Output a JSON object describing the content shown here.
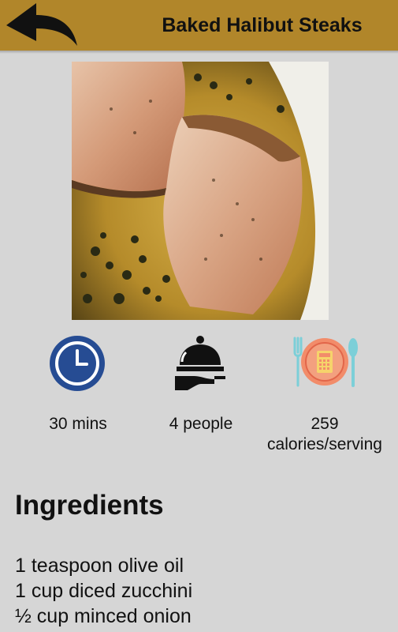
{
  "header": {
    "title": "Baked Halibut Steaks",
    "back_icon": "back-arrow-icon",
    "background_color": "#b1862a"
  },
  "recipe_image": {
    "alt": "Baked halibut steaks in butter sauce with capers"
  },
  "stats": {
    "time": {
      "icon": "clock-icon",
      "label": "30 mins"
    },
    "servings": {
      "icon": "serving-cloche-icon",
      "label": "4 people"
    },
    "calories": {
      "icon": "calculator-plate-icon",
      "value": "259",
      "unit": "calories/serving"
    }
  },
  "ingredients": {
    "heading": "Ingredients",
    "items": [
      "1 teaspoon olive oil",
      "1 cup diced zucchini",
      "½ cup minced onion"
    ]
  }
}
